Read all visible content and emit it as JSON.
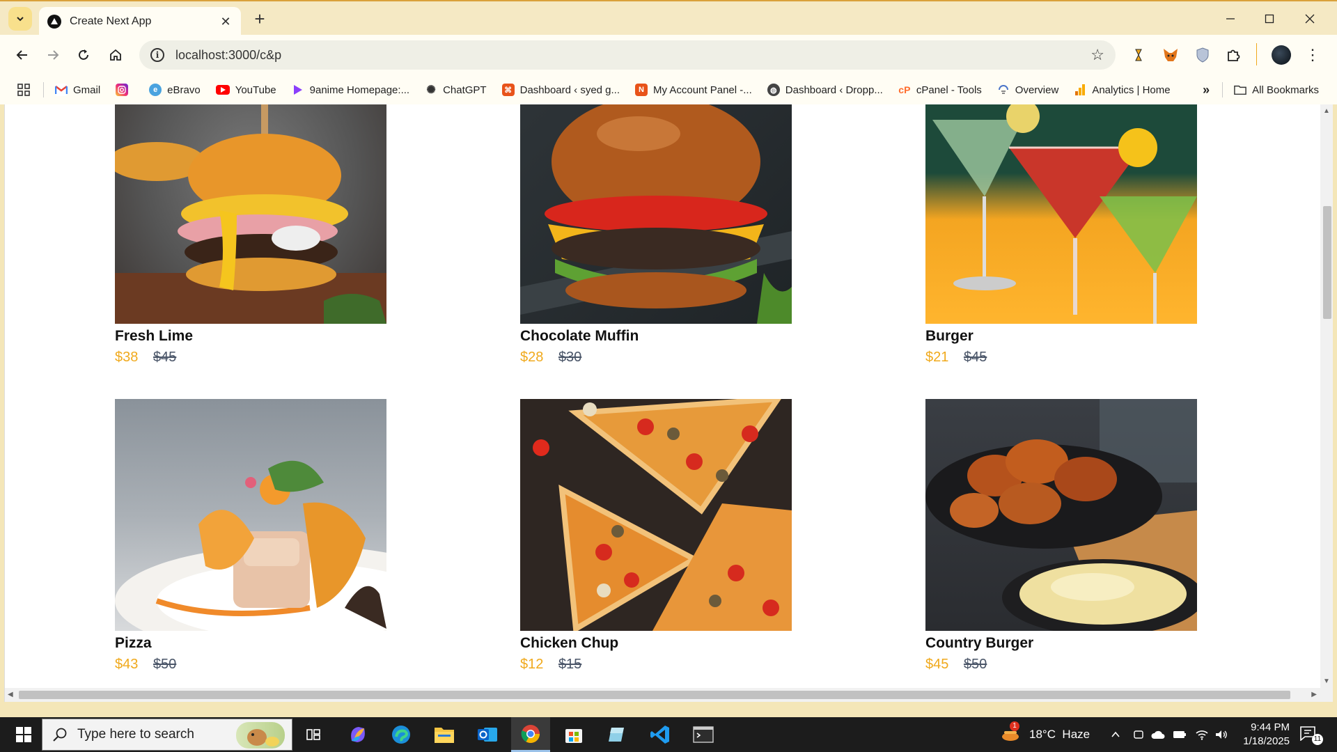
{
  "browser": {
    "tab_title": "Create Next App",
    "url": "localhost:3000/c&p"
  },
  "bookmarks": [
    {
      "label": "Gmail",
      "icon": "gmail-icon",
      "color": "#ea4335"
    },
    {
      "label": "",
      "icon": "instagram-icon",
      "color": "#d6249f"
    },
    {
      "label": "eBravo",
      "icon": "ebravo-icon",
      "color": "#4aa3df"
    },
    {
      "label": "YouTube",
      "icon": "youtube-icon",
      "color": "#ff0000"
    },
    {
      "label": "9anime Homepage:...",
      "icon": "9anime-icon",
      "color": "#8a3ffc"
    },
    {
      "label": "ChatGPT",
      "icon": "chatgpt-icon",
      "color": "#333333"
    },
    {
      "label": "Dashboard ‹ syed g...",
      "icon": "dashboard-icon",
      "color": "#e8531a"
    },
    {
      "label": "My Account Panel -...",
      "icon": "account-icon",
      "color": "#e8531a"
    },
    {
      "label": "Dashboard ‹ Dropp...",
      "icon": "globe-icon",
      "color": "#444444"
    },
    {
      "label": "cPanel - Tools",
      "icon": "cpanel-icon",
      "color": "#ff6c2c"
    },
    {
      "label": "Overview",
      "icon": "overview-icon",
      "color": "#4a74c9"
    },
    {
      "label": "Analytics | Home",
      "icon": "analytics-icon",
      "color": "#f9ab00"
    }
  ],
  "all_bookmarks_label": "All Bookmarks",
  "products": [
    {
      "name": "Fresh Lime",
      "price": "$38",
      "old_price": "$45"
    },
    {
      "name": "Chocolate Muffin",
      "price": "$28",
      "old_price": "$30"
    },
    {
      "name": "Burger",
      "price": "$21",
      "old_price": "$45"
    },
    {
      "name": "Pizza",
      "price": "$43",
      "old_price": "$50"
    },
    {
      "name": "Chicken Chup",
      "price": "$12",
      "old_price": "$15"
    },
    {
      "name": "Country Burger",
      "price": "$45",
      "old_price": "$50"
    }
  ],
  "taskbar": {
    "search_placeholder": "Type here to search",
    "weather": "18°C  Haze",
    "time": "9:44 PM",
    "date": "1/18/2025",
    "notifications": "11",
    "weather_badge": "1"
  },
  "colors": {
    "price": "#f0a91c",
    "old_price": "#4a5568",
    "titlebar": "#f5e9c4"
  }
}
